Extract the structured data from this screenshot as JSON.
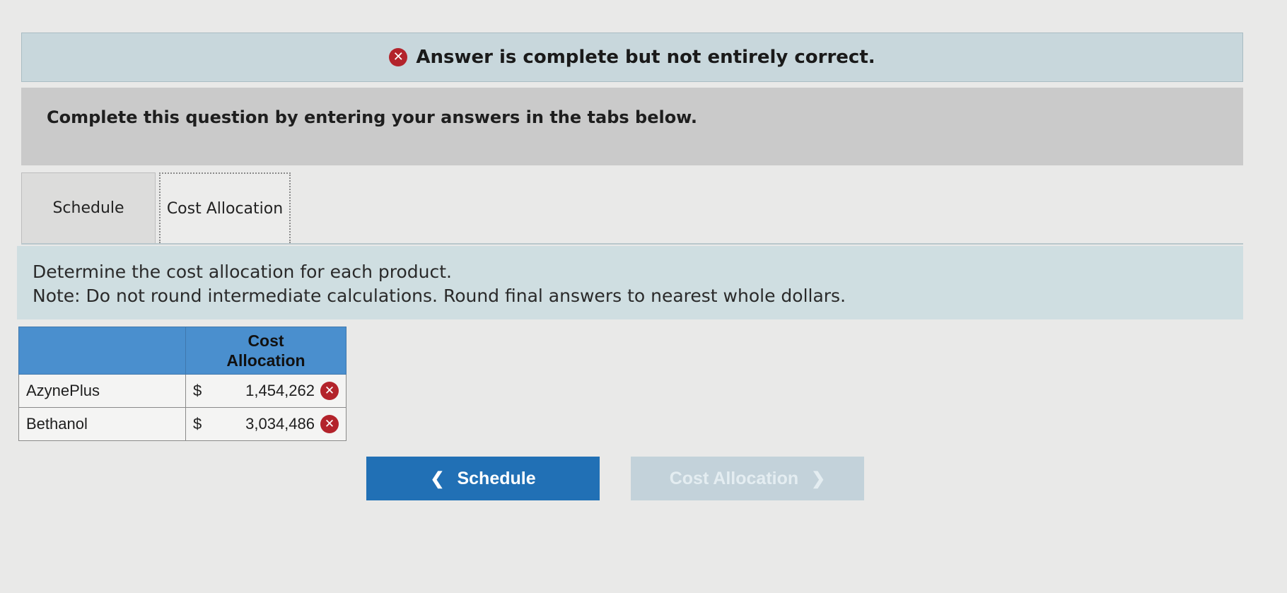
{
  "banner": {
    "icon": "x-circle-icon",
    "message": "Answer is complete but not entirely correct."
  },
  "instructions": {
    "text": "Complete this question by entering your answers in the tabs below."
  },
  "tabs": [
    {
      "label": "Schedule",
      "active": false
    },
    {
      "label": "Cost Allocation",
      "active": true
    }
  ],
  "prompt": {
    "line1": "Determine the cost allocation for each product.",
    "line2": "Note: Do not round intermediate calculations. Round final answers to nearest whole dollars."
  },
  "table": {
    "header_line1": "Cost",
    "header_line2": "Allocation",
    "rows": [
      {
        "product": "AzynePlus",
        "currency": "$",
        "value": "1,454,262",
        "status": "incorrect"
      },
      {
        "product": "Bethanol",
        "currency": "$",
        "value": "3,034,486",
        "status": "incorrect"
      }
    ]
  },
  "nav": {
    "prev_label": "Schedule",
    "next_label": "Cost Allocation",
    "prev_icon": "chevron-left-icon",
    "next_icon": "chevron-right-icon"
  },
  "colors": {
    "error": "#b3232b",
    "header_blue": "#4a8fce",
    "primary_button": "#2170b5",
    "disabled_button": "#c3d2da"
  }
}
